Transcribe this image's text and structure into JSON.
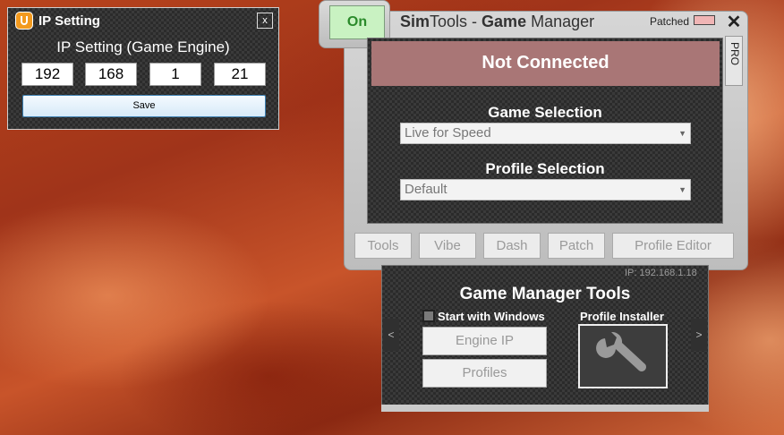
{
  "ip_window": {
    "title": "IP Setting",
    "close_label": "x",
    "heading": "IP Setting (Game Engine)",
    "ip_octets": [
      "192",
      "168",
      "1",
      "21"
    ],
    "save_label": "Save"
  },
  "main_window": {
    "on_label": "On",
    "title_sim": "Sim",
    "title_tools": "Tools - ",
    "title_game": "Game",
    "title_manager": " Manager",
    "patched_label": "Patched",
    "close_label": "✕",
    "pro_label": "PRO",
    "status": "Not Connected",
    "game_selection_label": "Game Selection",
    "game_selection_value": "Live for Speed",
    "profile_selection_label": "Profile Selection",
    "profile_selection_value": "Default",
    "tabs": [
      "Tools",
      "Vibe",
      "Dash",
      "Patch",
      "Profile Editor"
    ]
  },
  "tools_panel": {
    "ip_readout": "IP: 192.168.1.18",
    "title": "Game Manager Tools",
    "start_with_windows_label": "Start with Windows",
    "start_with_windows_checked": false,
    "profile_installer_label": "Profile Installer",
    "engine_ip_label": "Engine IP",
    "profiles_label": "Profiles",
    "left_arrow": "<",
    "right_arrow": ">"
  },
  "colors": {
    "on_button": "#c9f2c2",
    "status_bg": "#a97676",
    "patched_indicator": "#f0b5b5",
    "app_icon": "#f39a1f"
  },
  "icons": [
    "simtools-app-icon",
    "wrench-icon"
  ]
}
